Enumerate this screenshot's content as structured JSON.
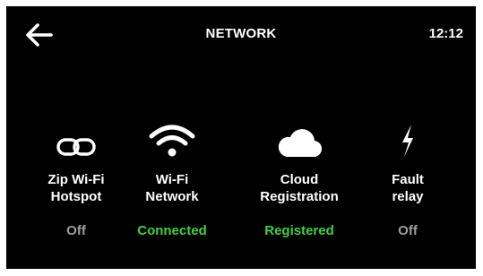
{
  "header": {
    "back_icon": "arrow-left-icon",
    "title": "NETWORK",
    "time": "12:12"
  },
  "tiles": [
    {
      "icon": "link-icon",
      "label_line1": "Zip Wi-Fi",
      "label_line2": "Hotspot",
      "status": "Off",
      "status_color": "#9e9e9e"
    },
    {
      "icon": "wifi-icon",
      "label_line1": "Wi-Fi",
      "label_line2": "Network",
      "status": "Connected",
      "status_color": "#3fd13f"
    },
    {
      "icon": "cloud-icon",
      "label_line1": "Cloud",
      "label_line2": "Registration",
      "status": "Registered",
      "status_color": "#3fd13f"
    },
    {
      "icon": "lightning-icon",
      "label_line1": "Fault",
      "label_line2": "relay",
      "status": "Off",
      "status_color": "#9e9e9e"
    }
  ],
  "colors": {
    "background": "#000000",
    "text": "#ffffff"
  }
}
